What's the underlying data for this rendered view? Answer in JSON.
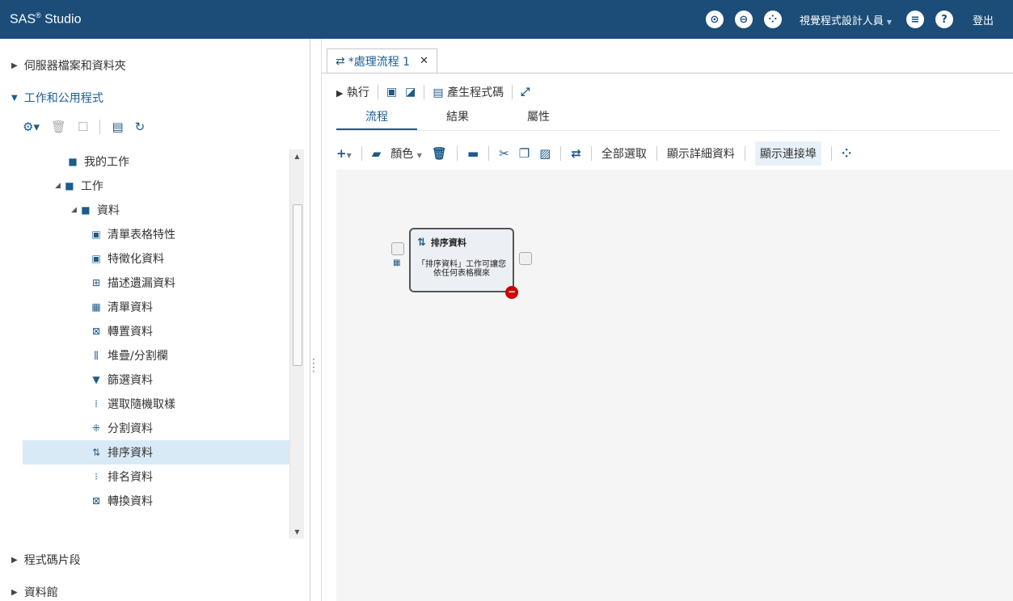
{
  "app": {
    "brand": "SAS",
    "brand_mark": "®",
    "brand_suffix": " Studio",
    "role": "視覺程式設計人員",
    "logout": "登出",
    "icons": [
      "search-icon",
      "window-icon",
      "grid-icon",
      "menu-icon",
      "help-icon"
    ]
  },
  "sidebar": {
    "sections": [
      {
        "label": "伺服器檔案和資料夾"
      },
      {
        "label": "工作和公用程式"
      },
      {
        "label": "程式碼片段"
      },
      {
        "label": "資料館"
      }
    ],
    "tree": [
      {
        "label": "我的工作"
      },
      {
        "label": "工作"
      },
      {
        "label": "資料"
      },
      {
        "label": "清單表格特性"
      },
      {
        "label": "特徵化資料"
      },
      {
        "label": "描述遺漏資料"
      },
      {
        "label": "清單資料"
      },
      {
        "label": "轉置資料"
      },
      {
        "label": "堆疊/分割欄"
      },
      {
        "label": "篩選資料"
      },
      {
        "label": "選取隨機取樣"
      },
      {
        "label": "分割資料"
      },
      {
        "label": "排序資料"
      },
      {
        "label": "排名資料"
      },
      {
        "label": "轉換資料"
      }
    ]
  },
  "main": {
    "tab_label": "*處理流程 1",
    "toolbar1": {
      "run": "執行",
      "generate": "產生程式碼"
    },
    "subtabs": [
      "流程",
      "結果",
      "屬性"
    ],
    "toolbar2": {
      "color": "顏色",
      "select_all": "全部選取",
      "show_details": "顯示詳細資料",
      "show_ports": "顯示連接埠"
    },
    "node": {
      "title": "排序資料",
      "desc": "「排序資料」工作可讓您依任何表格欄來"
    }
  }
}
